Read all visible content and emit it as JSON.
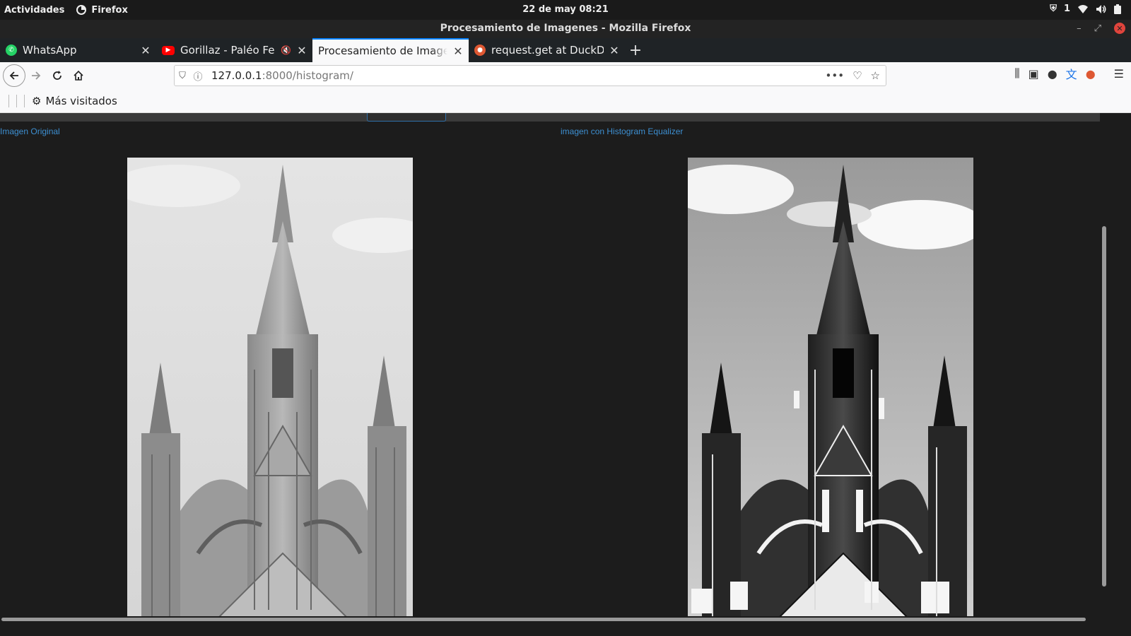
{
  "system_bar": {
    "activities": "Actividades",
    "app_name": "Firefox",
    "clock": "22 de may  08:21",
    "notification_count": "1"
  },
  "window": {
    "title": "Procesamiento de Imagenes - Mozilla Firefox"
  },
  "tabs": [
    {
      "label": "WhatsApp",
      "favicon": "whatsapp-icon",
      "active": false
    },
    {
      "label": "Gorillaz - Paléo Festival",
      "favicon": "youtube-icon",
      "active": false
    },
    {
      "label": "Procesamiento de Imagenes",
      "favicon": "",
      "active": true
    },
    {
      "label": "request.get at DuckDuckGo",
      "favicon": "duckduckgo-icon",
      "active": false
    }
  ],
  "urlbar": {
    "host": "127.0.0.1",
    "path": ":8000/histogram/"
  },
  "bookmarks": {
    "most_visited": "Más visitados"
  },
  "page": {
    "original_label": "Imagen Original",
    "equalized_label": "imagen con Histogram Equalizer"
  },
  "colors": {
    "accent": "#0a84ff",
    "link": "#3d8fd1",
    "page_bg": "#1c1c1c"
  }
}
